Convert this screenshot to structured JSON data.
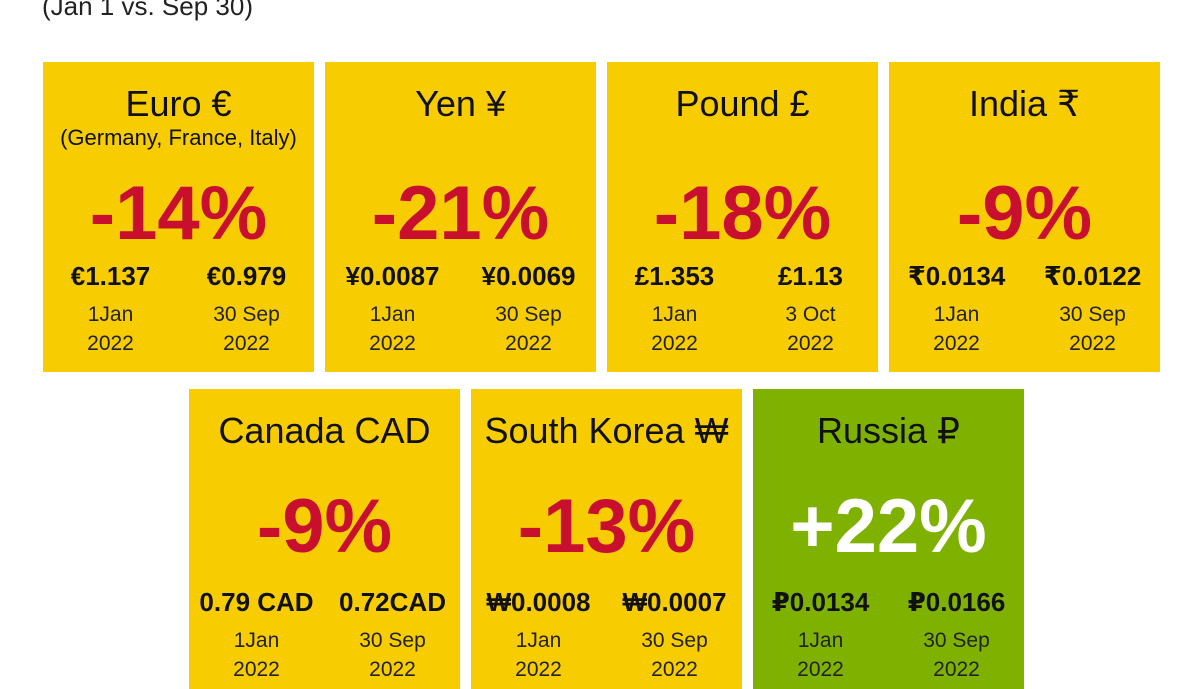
{
  "subtitle": "(Jan 1 vs. Sep 30)",
  "colors": {
    "card_down": "#f7cc00",
    "card_up": "#7fb200",
    "pct_down": "#c8102e",
    "pct_up": "#ffffff"
  },
  "chart_data": {
    "type": "table",
    "columns": [
      "currency",
      "note",
      "change",
      "start_value",
      "start_date",
      "end_value",
      "end_date"
    ],
    "rows": [
      {
        "id": "euro",
        "name": "Euro €",
        "note": "(Germany, France, Italy)",
        "change_pct": -14,
        "change_label": "-14%",
        "start_value": "€1.137",
        "start_date": "1Jan 2022",
        "end_value": "€0.979",
        "end_date": "30 Sep 2022"
      },
      {
        "id": "yen",
        "name": "Yen ¥",
        "note": "",
        "change_pct": -21,
        "change_label": "-21%",
        "start_value": "¥0.0087",
        "start_date": "1Jan 2022",
        "end_value": "¥0.0069",
        "end_date": "30 Sep 2022"
      },
      {
        "id": "pound",
        "name": "Pound £",
        "note": "",
        "change_pct": -18,
        "change_label": "-18%",
        "start_value": "£1.353",
        "start_date": "1Jan 2022",
        "end_value": "£1.13",
        "end_date": "3 Oct 2022"
      },
      {
        "id": "india",
        "name": "India ₹",
        "note": "",
        "change_pct": -9,
        "change_label": "-9%",
        "start_value": "₹0.0134",
        "start_date": "1Jan 2022",
        "end_value": "₹0.0122",
        "end_date": "30 Sep 2022"
      },
      {
        "id": "canada",
        "name": "Canada CAD",
        "note": "",
        "change_pct": -9,
        "change_label": "-9%",
        "start_value": "0.79 CAD",
        "start_date": "1Jan 2022",
        "end_value": "0.72CAD",
        "end_date": "30 Sep 2022"
      },
      {
        "id": "korea",
        "name": "South Korea ₩",
        "note": "",
        "change_pct": -13,
        "change_label": "-13%",
        "start_value": "₩0.0008",
        "start_date": "1Jan 2022",
        "end_value": "₩0.0007",
        "end_date": "30 Sep 2022"
      },
      {
        "id": "russia",
        "name": "Russia ₽",
        "note": "",
        "change_pct": 22,
        "change_label": "+22%",
        "start_value": "₽0.0134",
        "start_date": "1Jan 2022",
        "end_value": "₽0.0166",
        "end_date": "30 Sep 2022"
      }
    ]
  }
}
